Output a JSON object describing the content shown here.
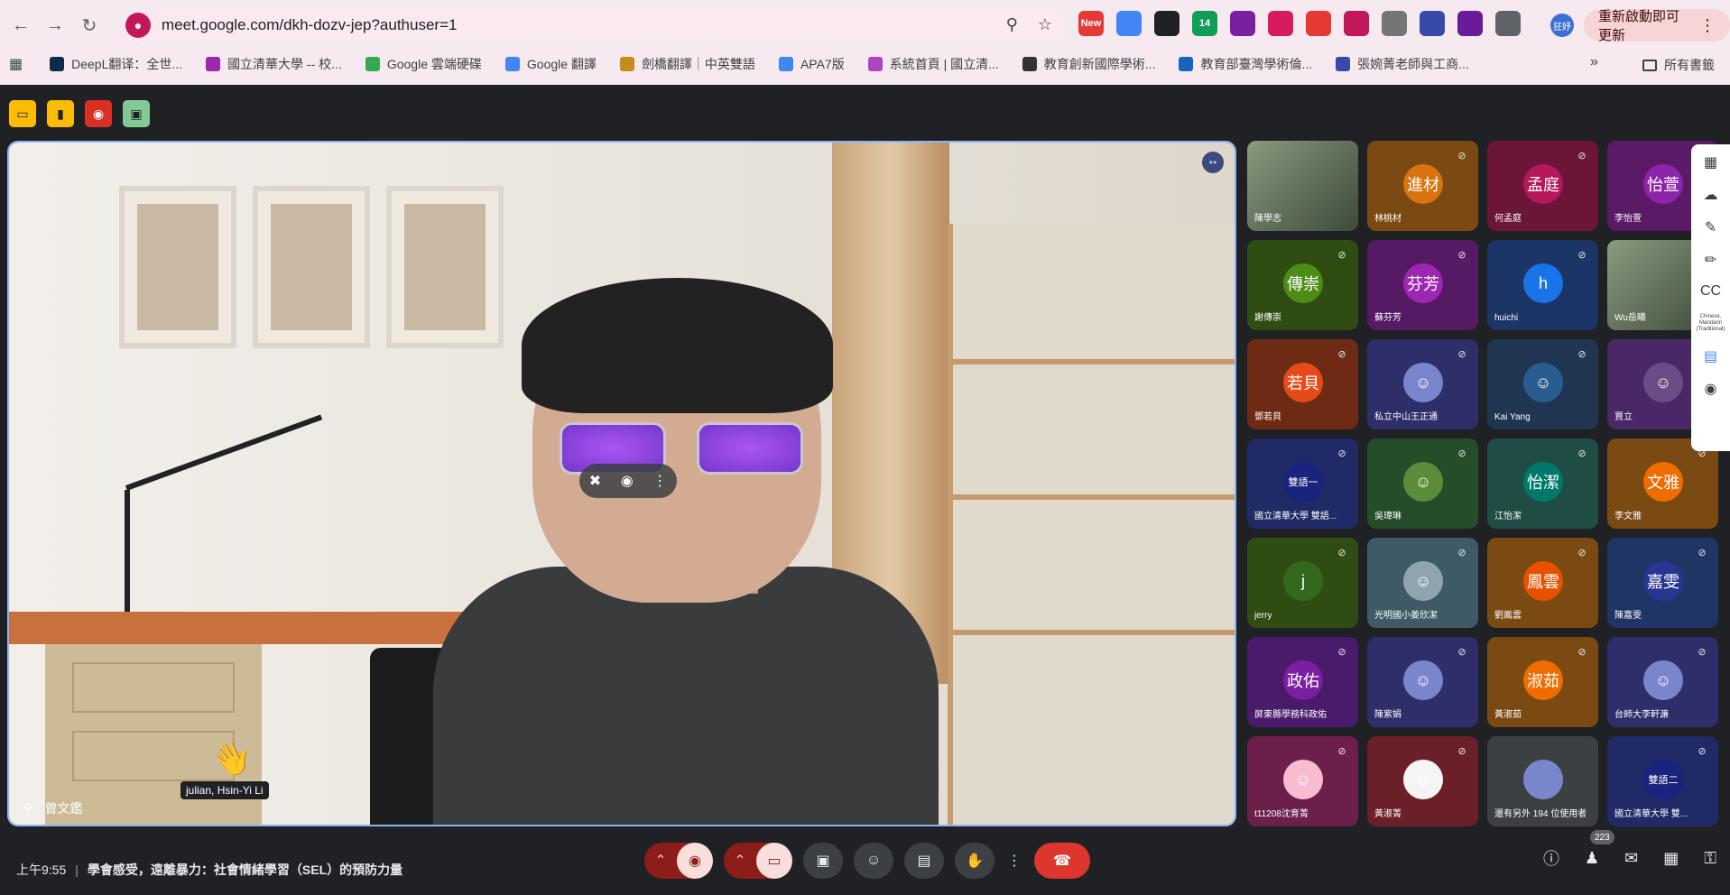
{
  "browser": {
    "url": "meet.google.com/dkh-dozv-jep?authuser=1",
    "update_button": "重新啟動即可更新",
    "profile_label": "狂妤",
    "extensions": [
      {
        "name": "new-extension-icon",
        "label": "New",
        "color": "#e53935"
      },
      {
        "name": "translate-extension-icon",
        "label": "",
        "color": "#4285f4"
      },
      {
        "name": "extension-icon",
        "label": "",
        "color": "#202124"
      },
      {
        "name": "calendar-extension-icon",
        "label": "14",
        "color": "#0f9d58"
      },
      {
        "name": "extension-icon",
        "label": "",
        "color": "#7b1fa2"
      },
      {
        "name": "extension-icon",
        "label": "",
        "color": "#d81b60"
      },
      {
        "name": "shield-extension-icon",
        "label": "",
        "color": "#e53935"
      },
      {
        "name": "extension-icon",
        "label": "",
        "color": "#c2185b"
      },
      {
        "name": "extension-icon",
        "label": "",
        "color": "#757575"
      },
      {
        "name": "extension-icon",
        "label": "",
        "color": "#3949ab"
      },
      {
        "name": "extension-icon",
        "label": "",
        "color": "#6a1b9a"
      },
      {
        "name": "puzzle-extension-icon",
        "label": "",
        "color": "#5f6368"
      }
    ],
    "bookmarks": [
      {
        "label": "DeepL翻译：全世...",
        "color": "#0f2b46"
      },
      {
        "label": "國立清華大學 -- 校...",
        "color": "#9c27b0"
      },
      {
        "label": "Google 雲端硬碟",
        "color": "#34a853"
      },
      {
        "label": "Google 翻譯",
        "color": "#4285f4"
      },
      {
        "label": "劍橋翻譯｜中英雙語",
        "color": "#c68c1e"
      },
      {
        "label": "APA7版",
        "color": "#4285f4"
      },
      {
        "label": "系統首頁 | 國立清...",
        "color": "#ab47bc"
      },
      {
        "label": "教育創新國際學術...",
        "color": "#333333"
      },
      {
        "label": "教育部臺灣學術倫...",
        "color": "#1565c0"
      },
      {
        "label": "張婉菁老師與工商...",
        "color": "#3949ab"
      }
    ],
    "bookmarks_all": "所有書籤"
  },
  "meet": {
    "speaker_name": "曾文鑑",
    "wave_label": "julian, Hsin-Yi Li",
    "time": "上午9:55",
    "meeting_title": "學會感受，遠離暴力：社會情緒學習（SEL）的預防力量",
    "participant_count": "223",
    "side_panel_caption": "Chinese, Mandarin (Traditional)",
    "tiles": [
      {
        "name": "陳學志",
        "avatar": "",
        "bg": "#5b6b55",
        "avbg": "",
        "video": true
      },
      {
        "name": "林桃材",
        "avatar": "進材",
        "bg": "#7a4a12",
        "avbg": "#d9730d"
      },
      {
        "name": "何孟庭",
        "avatar": "孟庭",
        "bg": "#6b1538",
        "avbg": "#b3185a"
      },
      {
        "name": "李怡萱",
        "avatar": "怡萱",
        "bg": "#5a1a66",
        "avbg": "#8e24aa"
      },
      {
        "name": "謝傳崇",
        "avatar": "傳崇",
        "bg": "#2f4d12",
        "avbg": "#4d8c16"
      },
      {
        "name": "蘇芬芳",
        "avatar": "芬芳",
        "bg": "#551a63",
        "avbg": "#9c27b0"
      },
      {
        "name": "huichi",
        "avatar": "h",
        "bg": "#1b3566",
        "avbg": "#1a73e8"
      },
      {
        "name": "Wu岳曦",
        "avatar": "",
        "bg": "#565f55",
        "avbg": "",
        "video": true
      },
      {
        "name": "鄧若貝",
        "avatar": "若貝",
        "bg": "#6e2a12",
        "avbg": "#e64a19"
      },
      {
        "name": "私立中山王正通",
        "avatar": "",
        "bg": "#2e2e6b",
        "avbg": "#7986cb"
      },
      {
        "name": "Kai Yang",
        "avatar": "",
        "bg": "#1f3552",
        "avbg": "#2a5d8f"
      },
      {
        "name": "賈立",
        "avatar": "",
        "bg": "#4a2766",
        "avbg": "#6a4c87"
      },
      {
        "name": "國立清華大學 雙語...",
        "avatar": "雙語一",
        "bg": "#1f2a66",
        "avbg": "#1a237e"
      },
      {
        "name": "吳瑋琳",
        "avatar": "",
        "bg": "#254d2a",
        "avbg": "#5b8c3a"
      },
      {
        "name": "江怡潔",
        "avatar": "怡潔",
        "bg": "#1f4d45",
        "avbg": "#00796b"
      },
      {
        "name": "李文雅",
        "avatar": "文雅",
        "bg": "#7a4a12",
        "avbg": "#ef6c00"
      },
      {
        "name": "jerry",
        "avatar": "j",
        "bg": "#2f4d12",
        "avbg": "#33691e"
      },
      {
        "name": "光明國小姜欣潔",
        "avatar": "",
        "bg": "#3d5a66",
        "avbg": "#90a4ae"
      },
      {
        "name": "劉鳳雲",
        "avatar": "鳳雲",
        "bg": "#7a4a12",
        "avbg": "#e65100"
      },
      {
        "name": "陳嘉雯",
        "avatar": "嘉雯",
        "bg": "#1f3566",
        "avbg": "#283593"
      },
      {
        "name": "屏東縣學務科政佑",
        "avatar": "政佑",
        "bg": "#4a1a6b",
        "avbg": "#7b1fa2"
      },
      {
        "name": "陳紫娟",
        "avatar": "",
        "bg": "#2e2e6b",
        "avbg": "#7986cb"
      },
      {
        "name": "黃淑茹",
        "avatar": "淑茹",
        "bg": "#7a4a12",
        "avbg": "#ef6c00"
      },
      {
        "name": "台師大李軒濂",
        "avatar": "",
        "bg": "#2e2e6b",
        "avbg": "#7986cb"
      },
      {
        "name": "t11208沈育菁",
        "avatar": "",
        "bg": "#6b1f4a",
        "avbg": "#f8bbd0"
      },
      {
        "name": "黃淑菁",
        "avatar": "",
        "bg": "#6b1f28",
        "avbg": "#f5f5f5"
      },
      {
        "name": "還有另外 194 位使用者",
        "avatar": "",
        "bg": "#3c4043",
        "avbg": "#7986cb",
        "others": true
      },
      {
        "name": "國立清華大學 雙...",
        "avatar": "雙語二",
        "bg": "#1f2a66",
        "avbg": "#1a237e"
      }
    ]
  },
  "colors": {
    "accent": "#8ab4f8",
    "hangup": "#dc362e",
    "mute": "#8c1d18"
  }
}
